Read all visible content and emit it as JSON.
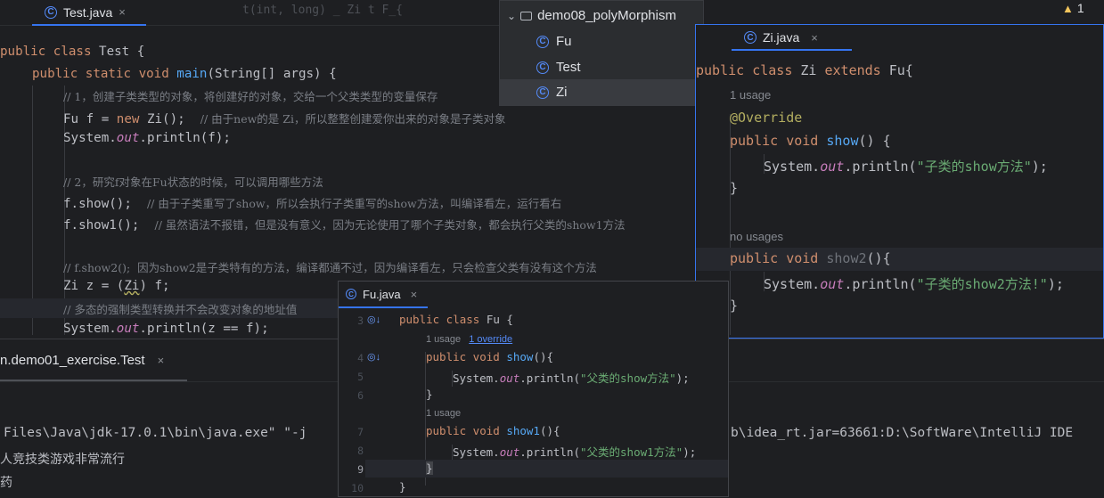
{
  "main_editor": {
    "tab_label": "Test.java",
    "tab_close": "×",
    "behind_text": "t(int, long) _ Zi t F_{",
    "warning_count": "1",
    "lines": {
      "l1_kw": "public class",
      "l1_rest": " Test {",
      "l2_kw": "public static void",
      "l2_fn": "main",
      "l2_rest": "(String[] args) {",
      "l3": "// 1，创建子类类型的对象，将创建好的对象，交给一个父类类型的变量保存",
      "l4_a": "Fu f = ",
      "l4_kw": "new",
      "l4_b": " Zi();  ",
      "l4_cm": "// 由于new的是 Zi，所以整整创建爱你出来的对象是子类对象",
      "l5_a": "System.",
      "l5_it": "out",
      "l5_b": ".println(f);",
      "l7": "// 2，研究f对象在Fu状态的时候，可以调用哪些方法",
      "l8_a": "f.show();  ",
      "l8_cm": "// 由于子类重写了show，所以会执行子类重写的show方法，叫编译看左，运行看右",
      "l9_a": "f.show1();  ",
      "l9_cm": "// 虽然语法不报错，但是没有意义，因为无论使用了哪个子类对象，都会执行父类的show1方法",
      "l11": "// f.show2();  因为show2是子类特有的方法，编译都通不过，因为编译看左，只会检查父类有没有这个方法",
      "l12_a": "Zi z = (",
      "l12_u": "Zi",
      "l12_b": ") f;",
      "l13": "// 多态的强制类型转换并不会改变对象的地址值",
      "l14_a": "System.",
      "l14_it": "out",
      "l14_b": ".println(z == f);"
    }
  },
  "project_popup": {
    "title": "demo08_polyMorphism",
    "items": [
      "Fu",
      "Test",
      "Zi"
    ],
    "selected": "Zi"
  },
  "zi_editor": {
    "tab_label": "Zi.java",
    "tab_close": "×",
    "l1_kw1": "public class",
    "l1_name": " Zi ",
    "l1_kw2": "extends",
    "l1_rest": " Fu{",
    "usage1": "1 usage",
    "annotation": "@Override",
    "l3_kw": "public void",
    "l3_fn": "show",
    "l3_rest": "() {",
    "l4_a": "System.",
    "l4_it": "out",
    "l4_b": ".println(",
    "l4_str": "\"子类的show方法\"",
    "l4_c": ");",
    "close1": "}",
    "usage2": "no usages",
    "l6_kw": "public void",
    "l6_fn": "show2",
    "l6_rest": "(){",
    "l7_a": "System.",
    "l7_it": "out",
    "l7_b": ".println(",
    "l7_str": "\"子类的show2方法!\"",
    "l7_c": ");",
    "close2": "}",
    "close3": "}"
  },
  "fu_editor": {
    "tab_label": "Fu.java",
    "tab_close": "×",
    "line_numbers": [
      "3",
      "4",
      "5",
      "6",
      "7",
      "8",
      "9",
      "10"
    ],
    "l1_kw": "public class",
    "l1_rest": " Fu {",
    "usage1": "1 usage",
    "override_link": "1 override",
    "l2_kw": "public void",
    "l2_fn": "show",
    "l2_rest": "(){",
    "l3_a": "System.",
    "l3_it": "out",
    "l3_b": ".println(",
    "l3_str": "\"父类的show方法\"",
    "l3_c": ");",
    "close1": "}",
    "usage2": "1 usage",
    "l5_kw": "public void",
    "l5_fn": "show1",
    "l5_rest": "(){",
    "l6_a": "System.",
    "l6_it": "out",
    "l6_b": ".println(",
    "l6_str": "\"父类的show1方法\"",
    "l6_c": ");",
    "close2": "}",
    "close3": "}"
  },
  "run_panel": {
    "tab_label": "n.demo01_exercise.Test",
    "tab_close": "×",
    "output_line1_left": "Files\\Java\\jdk-17.0.1\\bin\\java.exe\" \"-j",
    "output_line1_right": "b\\idea_rt.jar=63661:D:\\SoftWare\\IntelliJ IDE",
    "output_line2": "人竞技类游戏非常流行",
    "output_line3": "药"
  },
  "colors": {
    "background": "#1e1f22",
    "keyword": "#cf8e6d",
    "function": "#56a8f5",
    "comment": "#7a7e85",
    "string": "#6aab73",
    "accent": "#3574f0"
  }
}
